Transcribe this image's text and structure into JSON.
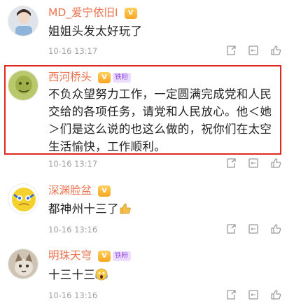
{
  "comments": [
    {
      "username": "MD_爱宁依旧I",
      "vip": "V",
      "text": "姐姐头发太好玩了",
      "time": "10-16 13:17"
    },
    {
      "username": "西河桥头",
      "vip": "V",
      "fan_badge": "铁粉",
      "text": "不负众望努力工作，一定圆满完成党和人民交给的各项任务，请党和人民放心。他＜她＞们是这么说的也这么做的，祝你们在太空生活愉快，工作顺利。",
      "time": "10-16 13:17"
    },
    {
      "username": "深渊脸盆",
      "vip": "V",
      "text": "都神州十三了",
      "emoji": "thumbs-up",
      "time": "10-16 13:16"
    },
    {
      "username": "明珠天穹",
      "vip": "V",
      "fan_badge": "铁粉",
      "text": "十三十三",
      "emoji": "scream",
      "time": "10-16 13:16"
    }
  ],
  "icons": [
    "share-icon",
    "comment-icon",
    "like-icon"
  ],
  "colors": {
    "username": "#eb7350",
    "highlight": "#e0281f",
    "meta": "#a0a0a0"
  }
}
